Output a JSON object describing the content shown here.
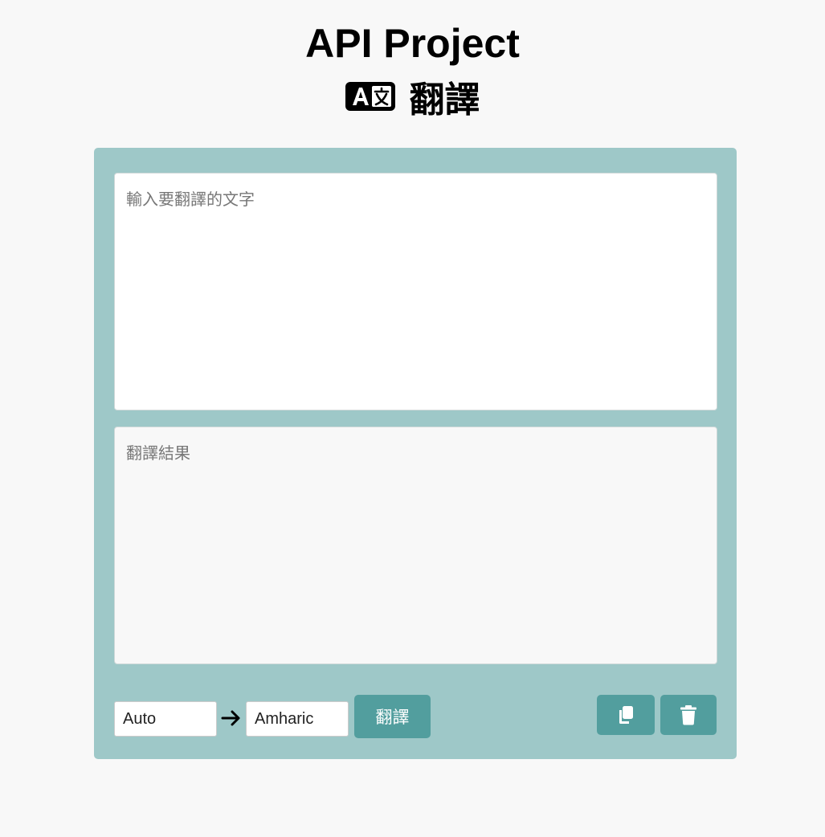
{
  "header": {
    "title": "API Project",
    "subtitle": "翻譯",
    "subtitle_icon": "translate-icon"
  },
  "source": {
    "placeholder": "輸入要翻譯的文字",
    "value": ""
  },
  "result": {
    "placeholder": "翻譯結果",
    "value": ""
  },
  "controls": {
    "from_language": "Auto",
    "arrow_icon": "arrow-right-icon",
    "to_language": "Amharic",
    "translate_label": "翻譯",
    "copy_icon": "copy-icon",
    "delete_icon": "trash-icon"
  },
  "colors": {
    "page_background": "#f8f8f8",
    "panel_background": "#9ec8c8",
    "button_background": "#529e9e",
    "button_text": "#ffffff"
  }
}
